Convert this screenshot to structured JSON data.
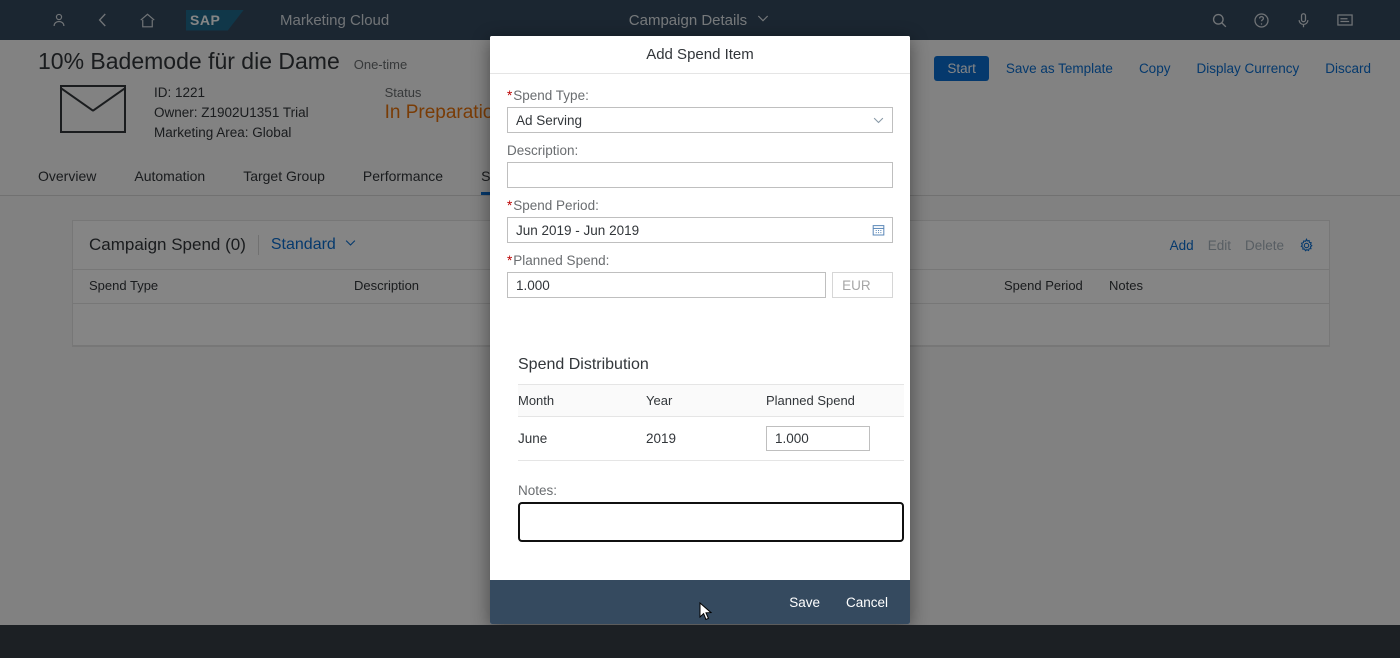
{
  "shell": {
    "product": "Marketing Cloud",
    "logo_text": "SAP",
    "center_title": "Campaign Details",
    "icons": {
      "user": "user-icon",
      "back": "back-icon",
      "home": "home-icon",
      "search": "search-icon",
      "help": "help-icon",
      "microphone": "microphone-icon",
      "menu": "menu-icon",
      "chevron_down": "chevron-down-icon"
    }
  },
  "object_header": {
    "title": "10% Bademode für die Dame",
    "subtitle": "One-time",
    "id": "ID: 1221",
    "owner": "Owner: Z1902U1351 Trial",
    "marketing_area": "Marketing Area: Global",
    "status_label": "Status",
    "status_value": "In Preparation",
    "status_color": "#e9730c",
    "actions": [
      {
        "label": "Start",
        "emphasized": true
      },
      {
        "label": "Save as Template",
        "emphasized": false
      },
      {
        "label": "Copy",
        "emphasized": false
      },
      {
        "label": "Display Currency",
        "emphasized": false
      },
      {
        "label": "Discard",
        "emphasized": false
      }
    ]
  },
  "tabs": [
    {
      "label": "Overview",
      "active": false
    },
    {
      "label": "Automation",
      "active": false
    },
    {
      "label": "Target Group",
      "active": false
    },
    {
      "label": "Performance",
      "active": false
    },
    {
      "label": "Spend",
      "active": true
    }
  ],
  "spend_table": {
    "title": "Campaign Spend (0)",
    "variant": "Standard",
    "actions": [
      {
        "label": "Add",
        "disabled": false
      },
      {
        "label": "Edit",
        "disabled": true
      },
      {
        "label": "Delete",
        "disabled": true
      }
    ],
    "settings_icon": "gear-icon",
    "columns": [
      "Spend Type",
      "Description",
      "Spend Period",
      "Notes"
    ],
    "rows": []
  },
  "dialog": {
    "title": "Add Spend Item",
    "fields": {
      "spend_type": {
        "label": "Spend Type:",
        "required": true,
        "value": "Ad Serving",
        "icon": "chevron-down-icon"
      },
      "description": {
        "label": "Description:",
        "required": false,
        "value": "",
        "placeholder": ""
      },
      "spend_period": {
        "label": "Spend Period:",
        "required": true,
        "value": "Jun 2019 - Jun 2019",
        "icon": "calendar-icon"
      },
      "planned_spend": {
        "label": "Planned Spend:",
        "required": true,
        "value": "1.000",
        "currency": "EUR"
      },
      "notes": {
        "label": "Notes:",
        "value": "",
        "focused": true
      }
    },
    "distribution": {
      "title": "Spend Distribution",
      "columns": [
        "Month",
        "Year",
        "Planned Spend"
      ],
      "rows": [
        {
          "month": "June",
          "year": "2019",
          "planned_spend": "1.000"
        }
      ]
    },
    "footer": {
      "save": "Save",
      "cancel": "Cancel"
    }
  },
  "theme": {
    "shell_bg": "#354a5f",
    "accent": "#0a6ed1",
    "required_marker": "#bb0000",
    "status_orange": "#e9730c"
  }
}
